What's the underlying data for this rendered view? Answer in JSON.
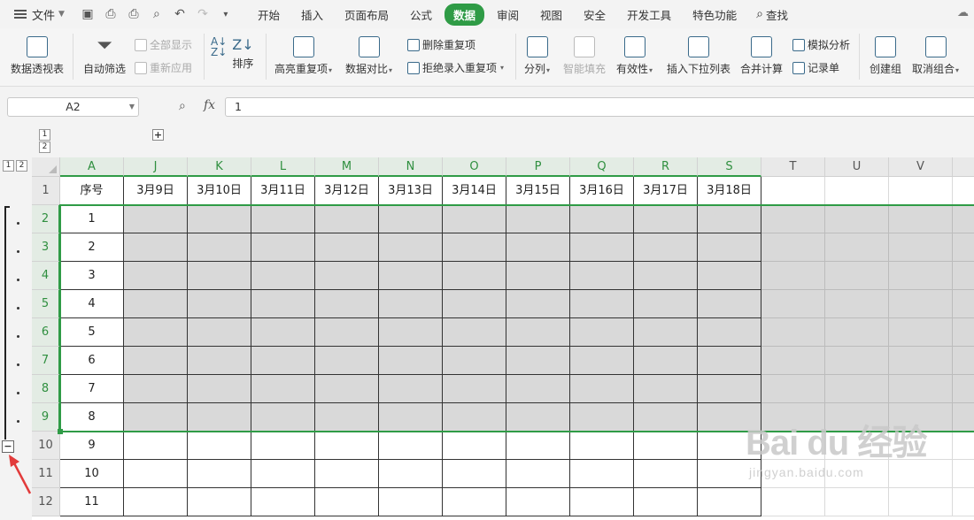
{
  "menubar": {
    "file_label": "文件",
    "tabs": [
      "开始",
      "插入",
      "页面布局",
      "公式",
      "数据",
      "审阅",
      "视图",
      "安全",
      "开发工具",
      "特色功能"
    ],
    "active_tab": "数据",
    "search_label": "查找",
    "accent_color": "#2f9b46"
  },
  "ribbon": {
    "pivot": "数据透视表",
    "autofilter": "自动筛选",
    "show_all": "全部显示",
    "reapply": "重新应用",
    "sort": "排序",
    "highlight_dup": "高亮重复项",
    "compare": "数据对比",
    "delete_dup": "删除重复项",
    "reject_dup": "拒绝录入重复项",
    "split": "分列",
    "smart_fill": "智能填充",
    "validity": "有效性",
    "insert_dropdown": "插入下拉列表",
    "consolidate": "合并计算",
    "simulate": "模拟分析",
    "record": "记录单",
    "create_group": "创建组",
    "ungroup": "取消组合"
  },
  "formula_bar": {
    "name_box": "A2",
    "fx": "fx",
    "value": "1"
  },
  "outline": {
    "top_levels": [
      "1",
      "2"
    ],
    "left_levels": [
      "1",
      "2"
    ],
    "expand": "+",
    "collapse": "−"
  },
  "sheet": {
    "columns": [
      "A",
      "J",
      "K",
      "L",
      "M",
      "N",
      "O",
      "P",
      "Q",
      "R",
      "S",
      "T",
      "U",
      "V",
      ""
    ],
    "header_row": [
      "序号",
      "3月9日",
      "3月10日",
      "3月11日",
      "3月12日",
      "3月13日",
      "3月14日",
      "3月15日",
      "3月16日",
      "3月17日",
      "3月18日"
    ],
    "rows": [
      {
        "num": "1",
        "a": ""
      },
      {
        "num": "2",
        "a": "1"
      },
      {
        "num": "3",
        "a": "2"
      },
      {
        "num": "4",
        "a": "3"
      },
      {
        "num": "5",
        "a": "4"
      },
      {
        "num": "6",
        "a": "5"
      },
      {
        "num": "7",
        "a": "6"
      },
      {
        "num": "8",
        "a": "7"
      },
      {
        "num": "9",
        "a": "8"
      },
      {
        "num": "10",
        "a": "9"
      },
      {
        "num": "11",
        "a": "10"
      },
      {
        "num": "12",
        "a": "11"
      }
    ],
    "selected_range": "A2",
    "selected_rows": [
      "2",
      "3",
      "4",
      "5",
      "6",
      "7",
      "8",
      "9"
    ]
  },
  "watermark": {
    "brand": "Bai du 经验",
    "url": "jingyan.baidu.com"
  }
}
